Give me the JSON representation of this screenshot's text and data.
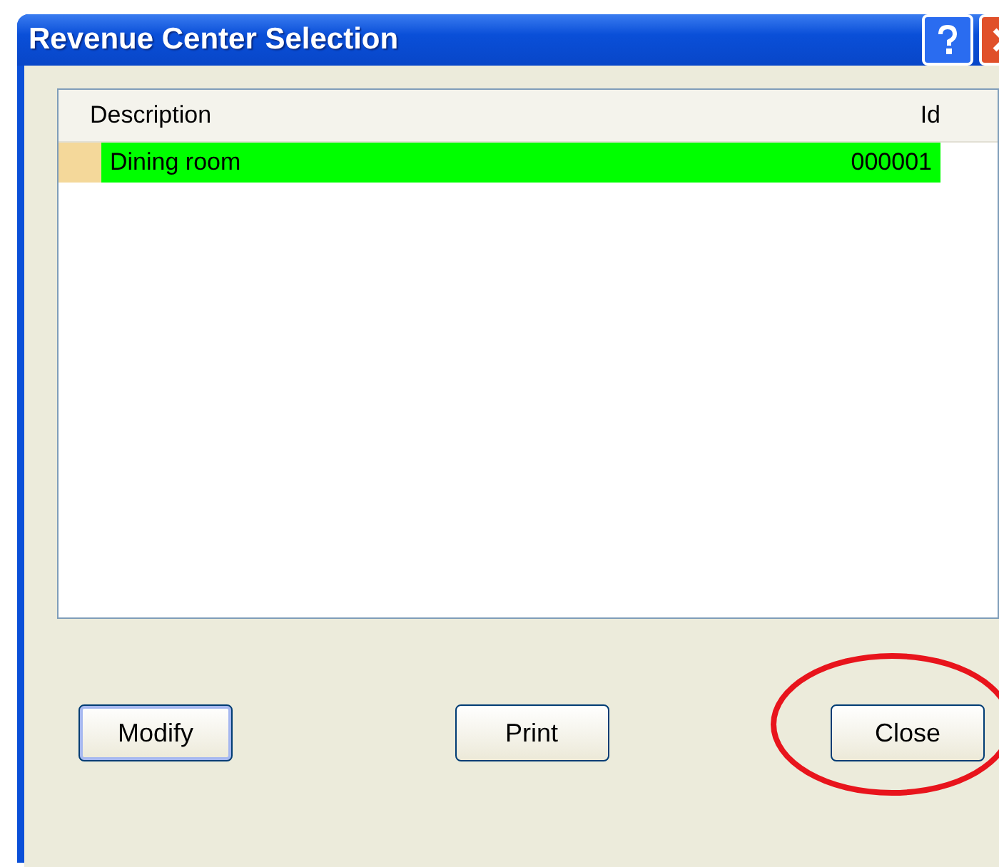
{
  "window": {
    "title": "Revenue Center Selection"
  },
  "table": {
    "columns": [
      "Description",
      "Id"
    ],
    "rows": [
      {
        "description": "Dining room",
        "id": "000001",
        "selected": true
      }
    ]
  },
  "buttons": [
    {
      "label": "Modify",
      "focused": true
    },
    {
      "label": "Print",
      "focused": false
    },
    {
      "label": "Close",
      "focused": false,
      "circled": true
    }
  ]
}
